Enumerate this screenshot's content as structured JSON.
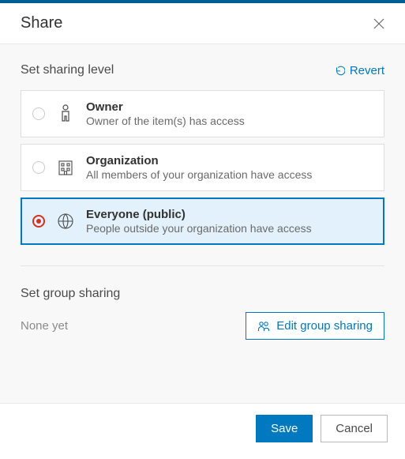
{
  "header": {
    "title": "Share"
  },
  "section1": {
    "title": "Set sharing level",
    "revert": "Revert",
    "options": {
      "owner": {
        "title": "Owner",
        "desc": "Owner of the item(s) has access",
        "selected": false
      },
      "org": {
        "title": "Organization",
        "desc": "All members of your organization have access",
        "selected": false
      },
      "everyone": {
        "title": "Everyone (public)",
        "desc": "People outside your organization have access",
        "selected": true
      }
    }
  },
  "section2": {
    "title": "Set group sharing",
    "none": "None yet",
    "edit": "Edit group sharing"
  },
  "footer": {
    "save": "Save",
    "cancel": "Cancel"
  }
}
